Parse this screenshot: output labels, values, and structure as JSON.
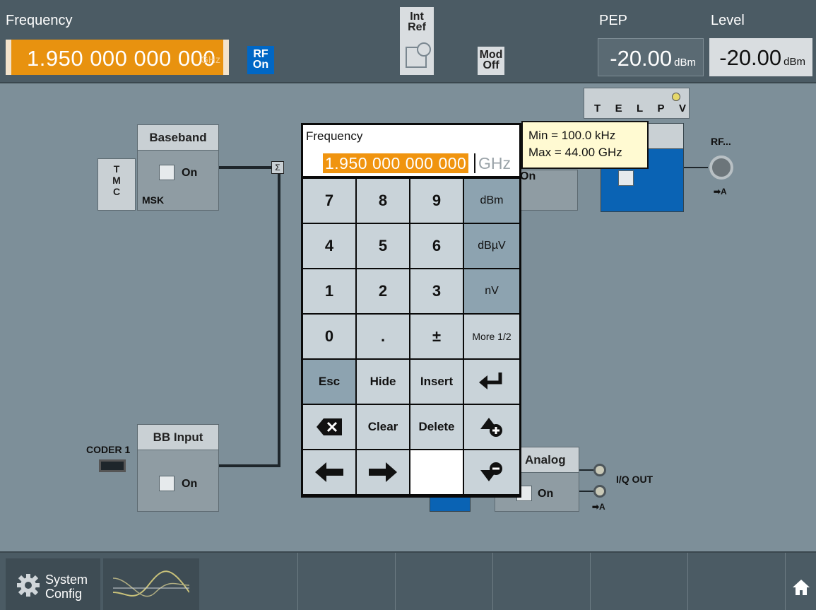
{
  "topbar": {
    "frequency_label": "Frequency",
    "frequency_value": "1.950 000 000 000",
    "frequency_unit": "GHz",
    "rf_chip": [
      "RF",
      "On"
    ],
    "intref_chip": [
      "Int",
      "Ref"
    ],
    "mod_chip": [
      "Mod",
      "Off"
    ],
    "pep_label": "PEP",
    "pep_value": "-20.00",
    "pep_unit": "dBm",
    "level_label": "Level",
    "level_value": "-20.00",
    "level_unit": "dBm"
  },
  "diagram": {
    "baseband": {
      "title": "Baseband",
      "checkbox_label": "On",
      "mode": "MSK",
      "side_tab": [
        "T",
        "M",
        "C"
      ]
    },
    "bb_input": {
      "title": "BB Input",
      "checkbox_label": "On",
      "coder_label": "CODER 1"
    },
    "sum_symbol": "Σ",
    "telpv": [
      "T",
      "E",
      "L",
      "P",
      "V"
    ],
    "rf_output": {
      "label": "RF...",
      "arrow_label": "➡A"
    },
    "iq_analog": {
      "title_fragment": "Analog",
      "checkbox_label": "On",
      "out_label": "I/Q OUT",
      "arrow_label": "➡A"
    },
    "hidden_block_checkbox_fragment": "On"
  },
  "keypad": {
    "title": "Frequency",
    "entry_value": "1.950 000 000 000",
    "entry_unit": "GHz",
    "rows": [
      [
        "7",
        "8",
        "9",
        "dBm"
      ],
      [
        "4",
        "5",
        "6",
        "dBµV"
      ],
      [
        "1",
        "2",
        "3",
        "nV"
      ],
      [
        "0",
        ".",
        "±",
        "More 1/2"
      ],
      [
        "Esc",
        "Hide",
        "Insert",
        "enter-icon"
      ],
      [
        "backspace-icon",
        "Clear",
        "Delete",
        "increment-icon"
      ],
      [
        "arrow-left-icon",
        "arrow-right-icon",
        "",
        "decrement-icon"
      ]
    ]
  },
  "tooltip": {
    "min_line": "Min = 100.0 kHz",
    "max_line": "Max = 44.00 GHz"
  },
  "taskbar": {
    "system_config": [
      "System",
      "Config"
    ],
    "icons": [
      "gear-icon",
      "waveform-icon",
      "home-icon"
    ]
  },
  "colors": {
    "accent_orange": "#e8920f",
    "rf_on_blue": "#0067c5",
    "background": "#7d8f99",
    "bar": "#4b5b64"
  }
}
